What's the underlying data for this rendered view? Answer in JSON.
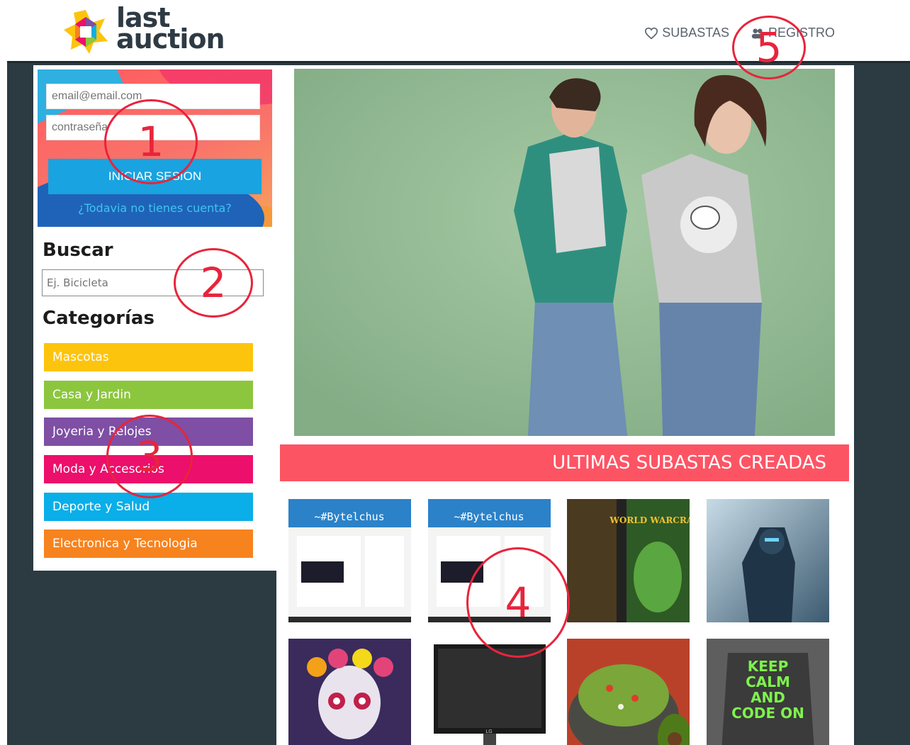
{
  "header": {
    "logo_line1": "last",
    "logo_line2": "auction",
    "nav": [
      {
        "label": "SUBASTAS",
        "icon": "heart-outline-icon"
      },
      {
        "label": "REGISTRO",
        "icon": "users-icon"
      }
    ]
  },
  "login": {
    "email_placeholder": "email@email.com",
    "password_placeholder": "contraseña",
    "submit_label": "INICIAR SESION",
    "register_link": "¿Todavia no tienes cuenta?"
  },
  "search": {
    "title": "Buscar",
    "placeholder": "Ej. Bicicleta"
  },
  "categories": {
    "title": "Categorías",
    "items": [
      {
        "label": "Mascotas",
        "color": "#fdc40d"
      },
      {
        "label": "Casa y Jardin",
        "color": "#8cc63e"
      },
      {
        "label": "Joyeria y Relojes",
        "color": "#7e4fa4"
      },
      {
        "label": "Moda y Accesorios",
        "color": "#ec0f6c"
      },
      {
        "label": "Deporte y Salud",
        "color": "#0aaee8"
      },
      {
        "label": "Electronica y Tecnologia",
        "color": "#f7831e"
      }
    ]
  },
  "latest": {
    "title": "ULTIMAS SUBASTAS CREADAS",
    "items": [
      {
        "image": "bytelchus-screenshot",
        "caption": "~#Bytelchus"
      },
      {
        "image": "bytelchus-screenshot",
        "caption": "~#Bytelchus"
      },
      {
        "image": "warcraft-game-box",
        "caption": "WORLD WARCRAFT"
      },
      {
        "image": "ice-knight-art",
        "caption": ""
      },
      {
        "image": "catrina-skull-art",
        "caption": ""
      },
      {
        "image": "lg-monitor",
        "caption": "LG"
      },
      {
        "image": "guacamole-bowl",
        "caption": ""
      },
      {
        "image": "keep-calm-code-on-shirt",
        "caption": "KEEP CALM AND CODE ON"
      }
    ]
  },
  "annotations": [
    "1",
    "2",
    "3",
    "4",
    "5"
  ],
  "colors": {
    "brand_red": "#fd5464",
    "dark_bg": "#2c3a42",
    "login_button": "#19a3e0"
  }
}
